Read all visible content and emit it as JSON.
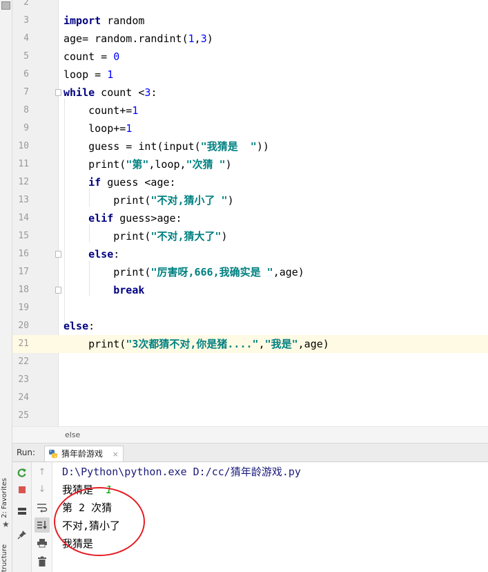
{
  "left_strip": {
    "favorites_label": "2: Favorites",
    "structure_label": "tructure"
  },
  "editor": {
    "lines": [
      {
        "n": "2",
        "segs": []
      },
      {
        "n": "3",
        "segs": [
          {
            "t": "import",
            "c": "kw"
          },
          {
            "t": " random",
            "c": ""
          }
        ]
      },
      {
        "n": "4",
        "segs": [
          {
            "t": "age= random.randint(",
            "c": ""
          },
          {
            "t": "1",
            "c": "num"
          },
          {
            "t": ",",
            "c": ""
          },
          {
            "t": "3",
            "c": "num"
          },
          {
            "t": ")",
            "c": ""
          }
        ]
      },
      {
        "n": "5",
        "segs": [
          {
            "t": "count = ",
            "c": ""
          },
          {
            "t": "0",
            "c": "num"
          }
        ]
      },
      {
        "n": "6",
        "segs": [
          {
            "t": "loop = ",
            "c": ""
          },
          {
            "t": "1",
            "c": "num"
          }
        ]
      },
      {
        "n": "7",
        "fold": true,
        "segs": [
          {
            "t": "while",
            "c": "kw"
          },
          {
            "t": " count <",
            "c": ""
          },
          {
            "t": "3",
            "c": "num"
          },
          {
            "t": ":",
            "c": ""
          }
        ]
      },
      {
        "n": "8",
        "segs": [
          {
            "t": "    count+=",
            "c": ""
          },
          {
            "t": "1",
            "c": "num"
          }
        ]
      },
      {
        "n": "9",
        "segs": [
          {
            "t": "    loop+=",
            "c": ""
          },
          {
            "t": "1",
            "c": "num"
          }
        ]
      },
      {
        "n": "10",
        "segs": [
          {
            "t": "    guess = int(input(",
            "c": ""
          },
          {
            "t": "\"我猜是  \"",
            "c": "str"
          },
          {
            "t": "))",
            "c": ""
          }
        ]
      },
      {
        "n": "11",
        "segs": [
          {
            "t": "    print(",
            "c": ""
          },
          {
            "t": "\"第\"",
            "c": "str"
          },
          {
            "t": ",loop,",
            "c": ""
          },
          {
            "t": "\"次猜 \"",
            "c": "str"
          },
          {
            "t": ")",
            "c": ""
          }
        ]
      },
      {
        "n": "12",
        "segs": [
          {
            "t": "    ",
            "c": ""
          },
          {
            "t": "if",
            "c": "kw"
          },
          {
            "t": " guess <age:",
            "c": ""
          }
        ]
      },
      {
        "n": "13",
        "segs": [
          {
            "t": "        print(",
            "c": ""
          },
          {
            "t": "\"不对,猜小了 \"",
            "c": "str"
          },
          {
            "t": ")",
            "c": ""
          }
        ]
      },
      {
        "n": "14",
        "segs": [
          {
            "t": "    ",
            "c": ""
          },
          {
            "t": "elif",
            "c": "kw"
          },
          {
            "t": " guess>age:",
            "c": ""
          }
        ]
      },
      {
        "n": "15",
        "segs": [
          {
            "t": "        print(",
            "c": ""
          },
          {
            "t": "\"不对,猜大了\"",
            "c": "str"
          },
          {
            "t": ")",
            "c": ""
          }
        ]
      },
      {
        "n": "16",
        "fold": true,
        "segs": [
          {
            "t": "    ",
            "c": ""
          },
          {
            "t": "else",
            "c": "kw"
          },
          {
            "t": ":",
            "c": ""
          }
        ]
      },
      {
        "n": "17",
        "segs": [
          {
            "t": "        print(",
            "c": ""
          },
          {
            "t": "\"厉害呀,666,我确实是 \"",
            "c": "str"
          },
          {
            "t": ",age)",
            "c": ""
          }
        ]
      },
      {
        "n": "18",
        "fold": true,
        "segs": [
          {
            "t": "        ",
            "c": ""
          },
          {
            "t": "break",
            "c": "kw"
          }
        ]
      },
      {
        "n": "19",
        "segs": []
      },
      {
        "n": "20",
        "segs": [
          {
            "t": "else",
            "c": "kw"
          },
          {
            "t": ":",
            "c": ""
          }
        ]
      },
      {
        "n": "21",
        "current": true,
        "segs": [
          {
            "t": "    print(",
            "c": ""
          },
          {
            "t": "\"3次都猜不对,你是猪....\"",
            "c": "str"
          },
          {
            "t": ",",
            "c": ""
          },
          {
            "t": "\"我是\"",
            "c": "str"
          },
          {
            "t": ",age)",
            "c": ""
          }
        ]
      },
      {
        "n": "22",
        "segs": []
      },
      {
        "n": "23",
        "segs": []
      },
      {
        "n": "24",
        "segs": []
      },
      {
        "n": "25",
        "segs": []
      }
    ]
  },
  "breadcrumb": {
    "text": "else"
  },
  "run": {
    "label": "Run:",
    "tab_label": "猜年龄游戏",
    "close_glyph": "×",
    "tools_left": [
      "rerun-icon",
      "stop-icon",
      "layout-icon",
      "pin-icon"
    ],
    "tools_right": [
      "up-arrow-icon",
      "down-arrow-icon",
      "soft-wrap-icon",
      "scroll-to-end-icon",
      "print-icon",
      "trash-icon"
    ],
    "console": {
      "command": "D:\\Python\\python.exe D:/cc/猜年龄游戏.py",
      "line1_prompt": "我猜是  ",
      "line1_input": "1",
      "line2": "第 2 次猜",
      "line3": "不对,猜小了",
      "line4": "我猜是"
    }
  },
  "colors": {
    "keyword": "#000080",
    "number": "#0000ff",
    "string": "#008080",
    "current_line": "#fffae3",
    "annotation": "#e51c23"
  }
}
